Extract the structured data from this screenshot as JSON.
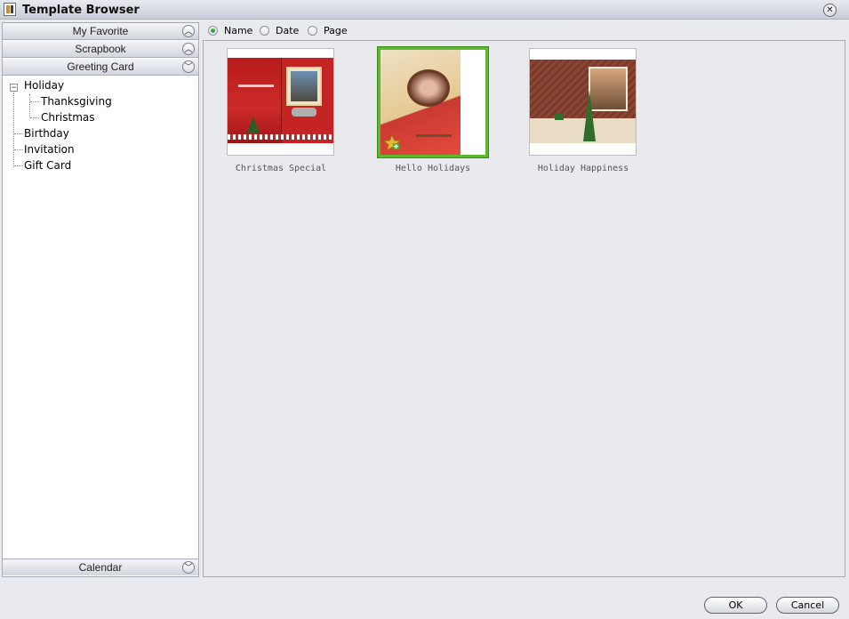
{
  "window": {
    "title": "Template Browser"
  },
  "sidebar": {
    "sections": [
      {
        "label": "My Favorite",
        "state": "collapsed"
      },
      {
        "label": "Scrapbook",
        "state": "collapsed"
      },
      {
        "label": "Greeting Card",
        "state": "expanded"
      }
    ],
    "tree": {
      "holiday": "Holiday",
      "thanksgiving": "Thanksgiving",
      "christmas": "Christmas",
      "birthday": "Birthday",
      "invitation": "Invitation",
      "gift_card": "Gift Card"
    },
    "bottom_section": {
      "label": "Calendar"
    }
  },
  "sort": {
    "options": [
      "Name",
      "Date",
      "Page"
    ],
    "selected": "Name"
  },
  "templates": [
    {
      "name": "Christmas Special",
      "selected": false
    },
    {
      "name": "Hello Holidays",
      "selected": true
    },
    {
      "name": "Holiday Happiness",
      "selected": false
    }
  ],
  "buttons": {
    "ok": "OK",
    "cancel": "Cancel"
  },
  "colors": {
    "selection_border": "#5cb82e",
    "radio_checked": "#3aa63a"
  }
}
